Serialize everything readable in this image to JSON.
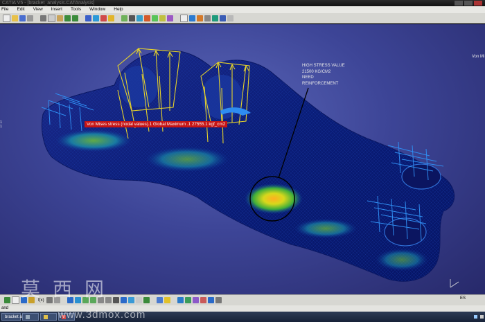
{
  "window": {
    "title": "CATIA V5 - [bracket_analysis.CATAnalysis]"
  },
  "menu": {
    "items": [
      "File",
      "Edit",
      "View",
      "Insert",
      "Tools",
      "Window",
      "Help"
    ]
  },
  "viewport": {
    "result_label": "Von Mises stress (nodal values).1   Global Maximum .1   27555.1 kgf_cm2",
    "annotation": {
      "line1": "HIGH STRESS VALUE",
      "line2": "21500 KG/CM2",
      "line3": "NEED",
      "line4": "REINFORCEMENT"
    },
    "right_label": "Von Mi",
    "side_label_1": "1",
    "side_label_2": "1"
  },
  "bottom_toolbar": {
    "fmt": "f(x)"
  },
  "status": {
    "text": "and"
  },
  "language": "ES",
  "taskbar": {
    "items": [
      {
        "label": "bracket a..."
      },
      {
        "label": ""
      },
      {
        "label": ""
      },
      {
        "label": ""
      }
    ]
  },
  "watermark": {
    "chars": "莫西网",
    "url": "www.3dmox.com"
  },
  "colors": {
    "viewport_bg": "#3d4597",
    "label_bg": "#c71414",
    "arrows": "#e8d42a",
    "constraints": "#2f8cf0"
  }
}
